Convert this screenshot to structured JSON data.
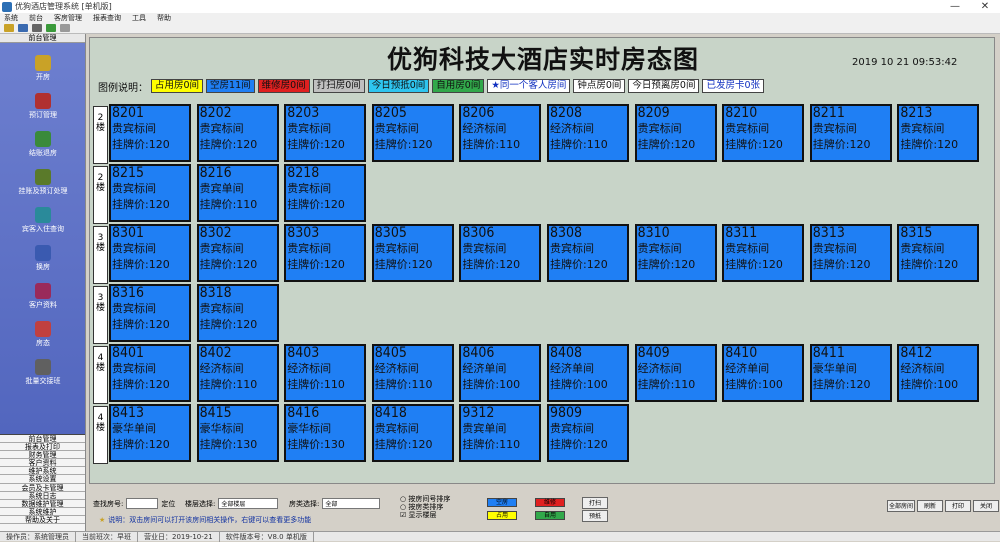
{
  "window": {
    "title": "优狗酒店管理系统 [单机版]",
    "minimize": "—",
    "close": "✕"
  },
  "menu": [
    "系统",
    "前台",
    "客房管理",
    "报表查询",
    "工具",
    "帮助"
  ],
  "toolbar_icons": [
    "open-icon",
    "find-icon",
    "print-icon",
    "refresh-icon",
    "help-icon"
  ],
  "sidebar": {
    "header": "前台管理",
    "items": [
      {
        "label": "开房",
        "icon": "key-icon",
        "color": "#c9a227"
      },
      {
        "label": "预订管理",
        "icon": "book-icon",
        "color": "#b03030"
      },
      {
        "label": "结账退房",
        "icon": "checkout-icon",
        "color": "#3a8a3a"
      },
      {
        "label": "挂账及预订处理",
        "icon": "money-icon",
        "color": "#5a7a2a"
      },
      {
        "label": "宾客入住查询",
        "icon": "search-icon",
        "color": "#2a8a9a"
      },
      {
        "label": "换房",
        "icon": "swap-icon",
        "color": "#3a5ab0"
      },
      {
        "label": "客户资料",
        "icon": "card-icon",
        "color": "#9a2a5a"
      },
      {
        "label": "房态",
        "icon": "chart-icon",
        "color": "#c04040"
      },
      {
        "label": "批量交接班",
        "icon": "list-icon",
        "color": "#606060"
      }
    ],
    "list": [
      "前台管理",
      "报表及打印",
      "财务管理",
      "客户资料",
      "维护系统",
      "系统设置",
      "会员及卡管理",
      "系统日志",
      "数据维护管理",
      "系统维护",
      "帮助及关于"
    ]
  },
  "main": {
    "title": "优狗科技大酒店实时房态图",
    "clock": "2019 10 21  09:53:42",
    "legend_label": "图例说明：",
    "legend": [
      {
        "label": "占用房0间",
        "bg": "#ffff00",
        "fg": "#111"
      },
      {
        "label": "空房11间",
        "bg": "#1f7ff4",
        "fg": "#111"
      },
      {
        "label": "维修房0间",
        "bg": "#e02020",
        "fg": "#111"
      },
      {
        "label": "打扫房0间",
        "bg": "#c0c0c0",
        "fg": "#111"
      },
      {
        "label": "今日预抵0间",
        "bg": "#2ec5ef",
        "fg": "#111"
      },
      {
        "label": "自用房0间",
        "bg": "#31a84a",
        "fg": "#111"
      },
      {
        "label": "★同一个客人房间",
        "bg": "#ffffff",
        "fg": "#1030c0"
      },
      {
        "label": "钟点房0间",
        "bg": "#ffffff",
        "fg": "#111"
      },
      {
        "label": "今日预离房0间",
        "bg": "#ffffff",
        "fg": "#111"
      },
      {
        "label": "已发房卡0张",
        "bg": "#ffffff",
        "fg": "#1030c0"
      }
    ],
    "floors": [
      {
        "label": "2楼",
        "rooms": [
          {
            "no": "8201",
            "type": "贵宾标间",
            "price": "挂牌价:120"
          },
          {
            "no": "8202",
            "type": "贵宾标间",
            "price": "挂牌价:120"
          },
          {
            "no": "8203",
            "type": "贵宾标间",
            "price": "挂牌价:120"
          },
          {
            "no": "8205",
            "type": "贵宾标间",
            "price": "挂牌价:120"
          },
          {
            "no": "8206",
            "type": "经济标间",
            "price": "挂牌价:110"
          },
          {
            "no": "8208",
            "type": "经济标间",
            "price": "挂牌价:110"
          },
          {
            "no": "8209",
            "type": "贵宾标间",
            "price": "挂牌价:120"
          },
          {
            "no": "8210",
            "type": "贵宾标间",
            "price": "挂牌价:120"
          },
          {
            "no": "8211",
            "type": "贵宾标间",
            "price": "挂牌价:120"
          },
          {
            "no": "8213",
            "type": "贵宾标间",
            "price": "挂牌价:120"
          }
        ]
      },
      {
        "label": "2楼",
        "rooms": [
          {
            "no": "8215",
            "type": "贵宾标间",
            "price": "挂牌价:120"
          },
          {
            "no": "8216",
            "type": "贵宾单间",
            "price": "挂牌价:110"
          },
          {
            "no": "8218",
            "type": "贵宾标间",
            "price": "挂牌价:120"
          }
        ]
      },
      {
        "label": "3楼",
        "rooms": [
          {
            "no": "8301",
            "type": "贵宾标间",
            "price": "挂牌价:120"
          },
          {
            "no": "8302",
            "type": "贵宾标间",
            "price": "挂牌价:120"
          },
          {
            "no": "8303",
            "type": "贵宾标间",
            "price": "挂牌价:120"
          },
          {
            "no": "8305",
            "type": "贵宾标间",
            "price": "挂牌价:120"
          },
          {
            "no": "8306",
            "type": "贵宾标间",
            "price": "挂牌价:120"
          },
          {
            "no": "8308",
            "type": "贵宾标间",
            "price": "挂牌价:120"
          },
          {
            "no": "8310",
            "type": "贵宾标间",
            "price": "挂牌价:120"
          },
          {
            "no": "8311",
            "type": "贵宾标间",
            "price": "挂牌价:120"
          },
          {
            "no": "8313",
            "type": "贵宾标间",
            "price": "挂牌价:120"
          },
          {
            "no": "8315",
            "type": "贵宾标间",
            "price": "挂牌价:120"
          }
        ]
      },
      {
        "label": "3楼",
        "rooms": [
          {
            "no": "8316",
            "type": "贵宾标间",
            "price": "挂牌价:120"
          },
          {
            "no": "8318",
            "type": "贵宾标间",
            "price": "挂牌价:120"
          }
        ]
      },
      {
        "label": "4楼",
        "rooms": [
          {
            "no": "8401",
            "type": "贵宾标间",
            "price": "挂牌价:120"
          },
          {
            "no": "8402",
            "type": "经济标间",
            "price": "挂牌价:110"
          },
          {
            "no": "8403",
            "type": "经济标间",
            "price": "挂牌价:110"
          },
          {
            "no": "8405",
            "type": "经济标间",
            "price": "挂牌价:110"
          },
          {
            "no": "8406",
            "type": "经济单间",
            "price": "挂牌价:100"
          },
          {
            "no": "8408",
            "type": "经济单间",
            "price": "挂牌价:100"
          },
          {
            "no": "8409",
            "type": "经济标间",
            "price": "挂牌价:110"
          },
          {
            "no": "8410",
            "type": "经济单间",
            "price": "挂牌价:100"
          },
          {
            "no": "8411",
            "type": "豪华单间",
            "price": "挂牌价:120"
          },
          {
            "no": "8412",
            "type": "经济标间",
            "price": "挂牌价:100"
          }
        ]
      },
      {
        "label": "4楼",
        "rooms": [
          {
            "no": "8413",
            "type": "豪华单间",
            "price": "挂牌价:120"
          },
          {
            "no": "8415",
            "type": "豪华标间",
            "price": "挂牌价:130"
          },
          {
            "no": "8416",
            "type": "豪华标间",
            "price": "挂牌价:130"
          },
          {
            "no": "8418",
            "type": "贵宾标间",
            "price": "挂牌价:120"
          },
          {
            "no": "9312",
            "type": "贵宾单间",
            "price": "挂牌价:110"
          },
          {
            "no": "9809",
            "type": "贵宾标间",
            "price": "挂牌价:120"
          }
        ]
      }
    ]
  },
  "bottom": {
    "room_search_label": "查找房号:",
    "room_search_btn": "定位",
    "floor_label": "楼层选择:",
    "floor_value": "全部楼层",
    "type_label": "房类选择:",
    "type_value": "全部",
    "opt1": "按房间号排序",
    "opt2": "按房类排序",
    "opt3": "显示楼层",
    "hint": "说明：双击房间可以打开该房间相关操作，右键可以查看更多功能",
    "color_btns": [
      {
        "label": "空房",
        "bg": "#1f7ff4"
      },
      {
        "label": "维修",
        "bg": "#e02020"
      },
      {
        "label": "占用",
        "bg": "#ffff00"
      },
      {
        "label": "自用",
        "bg": "#31a84a"
      }
    ],
    "small_btns": [
      "打扫",
      "预抵"
    ],
    "right_btns": [
      "全部房间",
      "刷新",
      "打印",
      "关闭"
    ]
  },
  "status": [
    "操作员：系统管理员",
    "当前班次：早班",
    "营业日：2019-10-21",
    "软件版本号：V8.0  单机版"
  ]
}
